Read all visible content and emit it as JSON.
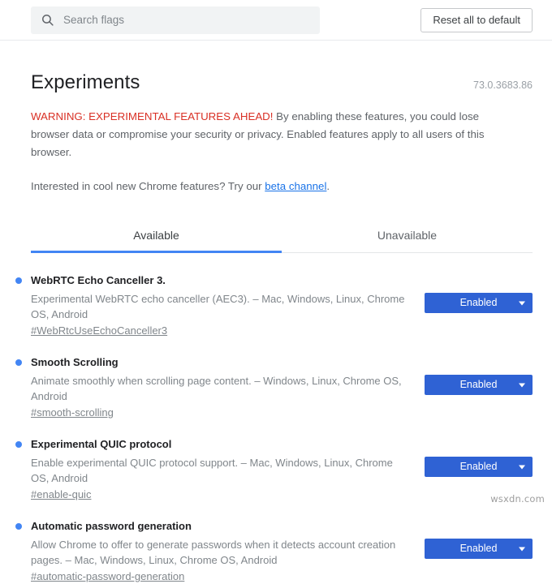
{
  "toolbar": {
    "search_placeholder": "Search flags",
    "search_value": "",
    "search_icon": "search-icon",
    "reset_label": "Reset all to default"
  },
  "header": {
    "title": "Experiments",
    "version": "73.0.3683.86",
    "warning_strong": "WARNING: EXPERIMENTAL FEATURES AHEAD!",
    "warning_rest": " By enabling these features, you could lose browser data or compromise your security or privacy. Enabled features apply to all users of this browser.",
    "beta_prefix": "Interested in cool new Chrome features? Try our ",
    "beta_link": "beta channel",
    "beta_suffix": "."
  },
  "tabs": [
    {
      "label": "Available",
      "active": true
    },
    {
      "label": "Unavailable",
      "active": false
    }
  ],
  "flags": [
    {
      "title": "WebRTC Echo Canceller 3.",
      "description": "Experimental WebRTC echo canceller (AEC3). – Mac, Windows, Linux, Chrome OS, Android",
      "permalink": "#WebRtcUseEchoCanceller3",
      "state": "Enabled"
    },
    {
      "title": "Smooth Scrolling",
      "description": "Animate smoothly when scrolling page content. – Windows, Linux, Chrome OS, Android",
      "permalink": "#smooth-scrolling",
      "state": "Enabled"
    },
    {
      "title": "Experimental QUIC protocol",
      "description": "Enable experimental QUIC protocol support. – Mac, Windows, Linux, Chrome OS, Android",
      "permalink": "#enable-quic",
      "state": "Enabled"
    },
    {
      "title": "Automatic password generation",
      "description": "Allow Chrome to offer to generate passwords when it detects account creation pages. – Mac, Windows, Linux, Chrome OS, Android",
      "permalink": "#automatic-password-generation",
      "state": "Enabled"
    }
  ],
  "watermark": "wsxdn.com",
  "colors": {
    "accent": "#4285f4",
    "select_blue": "#2f62d4",
    "warning_red": "#d93025",
    "link_blue": "#1a73e8",
    "muted_text": "#80868b"
  }
}
